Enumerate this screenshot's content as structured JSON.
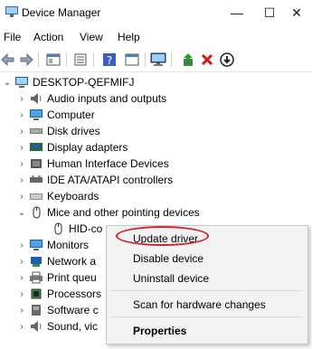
{
  "window": {
    "title": "Device Manager",
    "buttons": {
      "minimize": "—",
      "maximize": "☐",
      "close": "✕"
    }
  },
  "menu": [
    "File",
    "Action",
    "View",
    "Help"
  ],
  "toolbar": {
    "icons": [
      "back-icon",
      "forward-icon",
      "properties-icon",
      "show-hide-icon",
      "help-icon",
      "monitor-icon",
      "update-driver-icon",
      "uninstall-icon",
      "download-icon"
    ]
  },
  "tree": {
    "root": "DESKTOP-QEFMIFJ",
    "items": [
      "Audio inputs and outputs",
      "Computer",
      "Disk drives",
      "Display adapters",
      "Human Interface Devices",
      "IDE ATA/ATAPI controllers",
      "Keyboards",
      "Mice and other pointing devices",
      "HID-co",
      "Monitors",
      "Network a",
      "Print queu",
      "Processors",
      "Software c",
      "Sound, vic"
    ]
  },
  "context_menu": {
    "update": "Update driver",
    "disable": "Disable device",
    "uninstall": "Uninstall device",
    "scan": "Scan for hardware changes",
    "properties": "Properties"
  },
  "colors": {
    "highlight": "#d0212a",
    "menu_bg": "#f2f2f2"
  }
}
